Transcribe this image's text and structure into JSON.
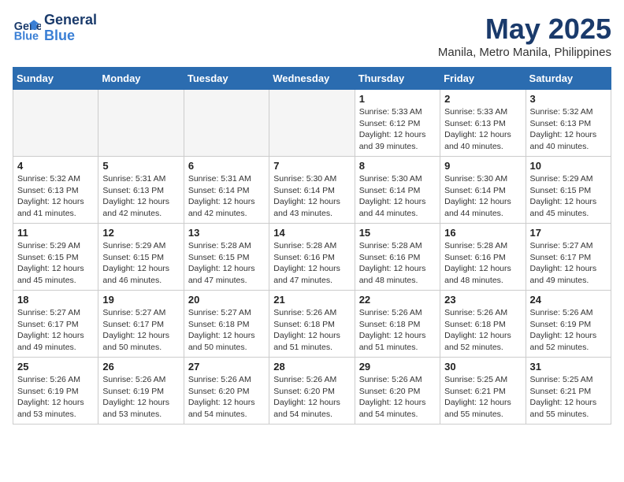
{
  "logo": {
    "line1": "General",
    "line2": "Blue"
  },
  "title": "May 2025",
  "location": "Manila, Metro Manila, Philippines",
  "days_of_week": [
    "Sunday",
    "Monday",
    "Tuesday",
    "Wednesday",
    "Thursday",
    "Friday",
    "Saturday"
  ],
  "weeks": [
    [
      {
        "day": "",
        "sunrise": "",
        "sunset": "",
        "daylight": ""
      },
      {
        "day": "",
        "sunrise": "",
        "sunset": "",
        "daylight": ""
      },
      {
        "day": "",
        "sunrise": "",
        "sunset": "",
        "daylight": ""
      },
      {
        "day": "",
        "sunrise": "",
        "sunset": "",
        "daylight": ""
      },
      {
        "day": "1",
        "sunrise": "Sunrise: 5:33 AM",
        "sunset": "Sunset: 6:12 PM",
        "daylight": "Daylight: 12 hours and 39 minutes."
      },
      {
        "day": "2",
        "sunrise": "Sunrise: 5:33 AM",
        "sunset": "Sunset: 6:13 PM",
        "daylight": "Daylight: 12 hours and 40 minutes."
      },
      {
        "day": "3",
        "sunrise": "Sunrise: 5:32 AM",
        "sunset": "Sunset: 6:13 PM",
        "daylight": "Daylight: 12 hours and 40 minutes."
      }
    ],
    [
      {
        "day": "4",
        "sunrise": "Sunrise: 5:32 AM",
        "sunset": "Sunset: 6:13 PM",
        "daylight": "Daylight: 12 hours and 41 minutes."
      },
      {
        "day": "5",
        "sunrise": "Sunrise: 5:31 AM",
        "sunset": "Sunset: 6:13 PM",
        "daylight": "Daylight: 12 hours and 42 minutes."
      },
      {
        "day": "6",
        "sunrise": "Sunrise: 5:31 AM",
        "sunset": "Sunset: 6:14 PM",
        "daylight": "Daylight: 12 hours and 42 minutes."
      },
      {
        "day": "7",
        "sunrise": "Sunrise: 5:30 AM",
        "sunset": "Sunset: 6:14 PM",
        "daylight": "Daylight: 12 hours and 43 minutes."
      },
      {
        "day": "8",
        "sunrise": "Sunrise: 5:30 AM",
        "sunset": "Sunset: 6:14 PM",
        "daylight": "Daylight: 12 hours and 44 minutes."
      },
      {
        "day": "9",
        "sunrise": "Sunrise: 5:30 AM",
        "sunset": "Sunset: 6:14 PM",
        "daylight": "Daylight: 12 hours and 44 minutes."
      },
      {
        "day": "10",
        "sunrise": "Sunrise: 5:29 AM",
        "sunset": "Sunset: 6:15 PM",
        "daylight": "Daylight: 12 hours and 45 minutes."
      }
    ],
    [
      {
        "day": "11",
        "sunrise": "Sunrise: 5:29 AM",
        "sunset": "Sunset: 6:15 PM",
        "daylight": "Daylight: 12 hours and 45 minutes."
      },
      {
        "day": "12",
        "sunrise": "Sunrise: 5:29 AM",
        "sunset": "Sunset: 6:15 PM",
        "daylight": "Daylight: 12 hours and 46 minutes."
      },
      {
        "day": "13",
        "sunrise": "Sunrise: 5:28 AM",
        "sunset": "Sunset: 6:15 PM",
        "daylight": "Daylight: 12 hours and 47 minutes."
      },
      {
        "day": "14",
        "sunrise": "Sunrise: 5:28 AM",
        "sunset": "Sunset: 6:16 PM",
        "daylight": "Daylight: 12 hours and 47 minutes."
      },
      {
        "day": "15",
        "sunrise": "Sunrise: 5:28 AM",
        "sunset": "Sunset: 6:16 PM",
        "daylight": "Daylight: 12 hours and 48 minutes."
      },
      {
        "day": "16",
        "sunrise": "Sunrise: 5:28 AM",
        "sunset": "Sunset: 6:16 PM",
        "daylight": "Daylight: 12 hours and 48 minutes."
      },
      {
        "day": "17",
        "sunrise": "Sunrise: 5:27 AM",
        "sunset": "Sunset: 6:17 PM",
        "daylight": "Daylight: 12 hours and 49 minutes."
      }
    ],
    [
      {
        "day": "18",
        "sunrise": "Sunrise: 5:27 AM",
        "sunset": "Sunset: 6:17 PM",
        "daylight": "Daylight: 12 hours and 49 minutes."
      },
      {
        "day": "19",
        "sunrise": "Sunrise: 5:27 AM",
        "sunset": "Sunset: 6:17 PM",
        "daylight": "Daylight: 12 hours and 50 minutes."
      },
      {
        "day": "20",
        "sunrise": "Sunrise: 5:27 AM",
        "sunset": "Sunset: 6:18 PM",
        "daylight": "Daylight: 12 hours and 50 minutes."
      },
      {
        "day": "21",
        "sunrise": "Sunrise: 5:26 AM",
        "sunset": "Sunset: 6:18 PM",
        "daylight": "Daylight: 12 hours and 51 minutes."
      },
      {
        "day": "22",
        "sunrise": "Sunrise: 5:26 AM",
        "sunset": "Sunset: 6:18 PM",
        "daylight": "Daylight: 12 hours and 51 minutes."
      },
      {
        "day": "23",
        "sunrise": "Sunrise: 5:26 AM",
        "sunset": "Sunset: 6:18 PM",
        "daylight": "Daylight: 12 hours and 52 minutes."
      },
      {
        "day": "24",
        "sunrise": "Sunrise: 5:26 AM",
        "sunset": "Sunset: 6:19 PM",
        "daylight": "Daylight: 12 hours and 52 minutes."
      }
    ],
    [
      {
        "day": "25",
        "sunrise": "Sunrise: 5:26 AM",
        "sunset": "Sunset: 6:19 PM",
        "daylight": "Daylight: 12 hours and 53 minutes."
      },
      {
        "day": "26",
        "sunrise": "Sunrise: 5:26 AM",
        "sunset": "Sunset: 6:19 PM",
        "daylight": "Daylight: 12 hours and 53 minutes."
      },
      {
        "day": "27",
        "sunrise": "Sunrise: 5:26 AM",
        "sunset": "Sunset: 6:20 PM",
        "daylight": "Daylight: 12 hours and 54 minutes."
      },
      {
        "day": "28",
        "sunrise": "Sunrise: 5:26 AM",
        "sunset": "Sunset: 6:20 PM",
        "daylight": "Daylight: 12 hours and 54 minutes."
      },
      {
        "day": "29",
        "sunrise": "Sunrise: 5:26 AM",
        "sunset": "Sunset: 6:20 PM",
        "daylight": "Daylight: 12 hours and 54 minutes."
      },
      {
        "day": "30",
        "sunrise": "Sunrise: 5:25 AM",
        "sunset": "Sunset: 6:21 PM",
        "daylight": "Daylight: 12 hours and 55 minutes."
      },
      {
        "day": "31",
        "sunrise": "Sunrise: 5:25 AM",
        "sunset": "Sunset: 6:21 PM",
        "daylight": "Daylight: 12 hours and 55 minutes."
      }
    ]
  ]
}
